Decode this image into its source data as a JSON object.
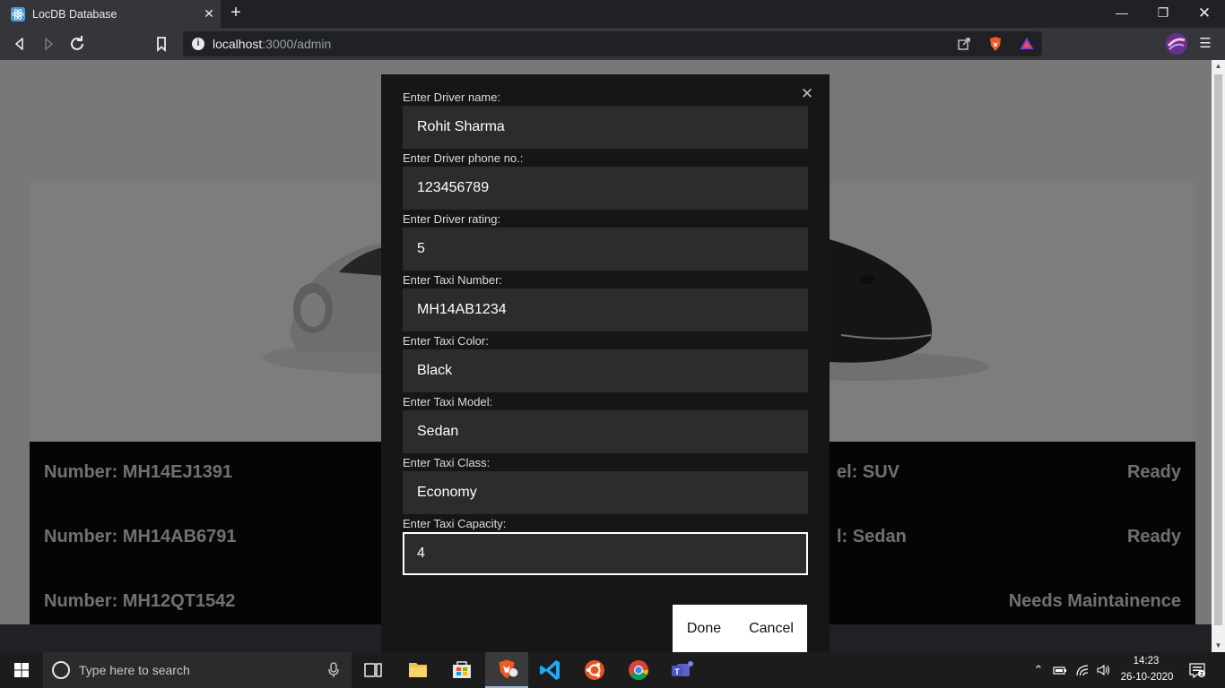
{
  "browser": {
    "tab_title": "LocDB Database",
    "url_host": "localhost",
    "url_path": ":3000/admin",
    "icons": [
      "react-favicon-icon",
      "back-icon",
      "forward-icon",
      "reload-icon",
      "bookmark-icon",
      "info-icon",
      "external-link-icon",
      "brave-shield-icon",
      "brave-rewards-icon",
      "profile-avatar-icon",
      "menu-icon",
      "minimize-icon",
      "restore-icon",
      "close-icon"
    ]
  },
  "modal": {
    "fields": [
      {
        "label": "Enter Driver name:",
        "value": "Rohit Sharma"
      },
      {
        "label": "Enter Driver phone no.:",
        "value": "123456789"
      },
      {
        "label": "Enter Driver rating:",
        "value": "5"
      },
      {
        "label": "Enter Taxi Number:",
        "value": "MH14AB1234"
      },
      {
        "label": "Enter Taxi Color:",
        "value": "Black"
      },
      {
        "label": "Enter Taxi Model:",
        "value": "Sedan"
      },
      {
        "label": "Enter Taxi Class:",
        "value": "Economy"
      },
      {
        "label": "Enter Taxi Capacity:",
        "value": "4"
      }
    ],
    "done_label": "Done",
    "cancel_label": "Cancel"
  },
  "taxis": [
    {
      "number": "Number: MH14EJ1391",
      "model": "el: SUV",
      "status": "Ready"
    },
    {
      "number": "Number: MH14AB6791",
      "model": "l: Sedan",
      "status": "Ready"
    },
    {
      "number": "Number: MH12QT1542",
      "model": "",
      "status": "Needs Maintainence"
    }
  ],
  "taskbar": {
    "search_placeholder": "Type here to search",
    "time": "14:23",
    "date": "26-10-2020",
    "apps": [
      "task-view-icon",
      "file-explorer-icon",
      "store-icon",
      "brave-icon",
      "vscode-icon",
      "ubuntu-icon",
      "chrome-icon",
      "teams-icon"
    ]
  },
  "colors": {
    "modal_bg": "#161616",
    "input_bg": "#2c2c2c",
    "taxi_list_bg": "#0a0a0a",
    "taskbar_bg": "#1c1c1c"
  }
}
